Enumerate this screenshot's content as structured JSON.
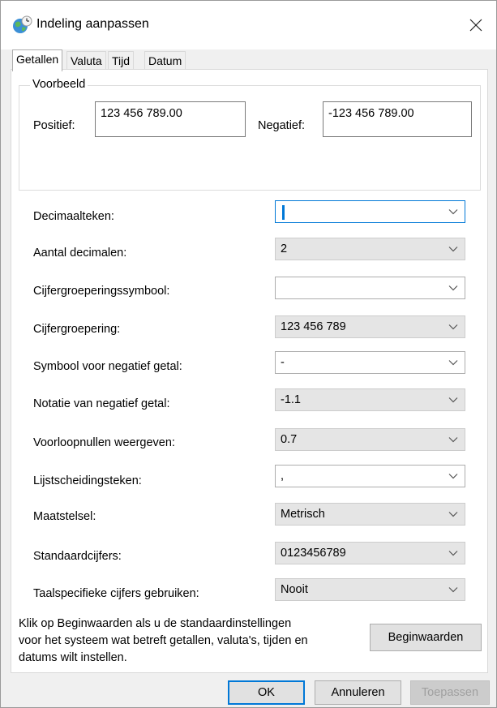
{
  "window": {
    "title": "Indeling aanpassen",
    "icon": "globe-clock-icon"
  },
  "tabs": [
    {
      "label": "Getallen",
      "active": true
    },
    {
      "label": "Valuta",
      "active": false
    },
    {
      "label": "Tijd",
      "active": false
    },
    {
      "label": "Datum",
      "active": false
    }
  ],
  "preview": {
    "legend": "Voorbeeld",
    "positive_label": "Positief:",
    "positive_value": "123 456 789.00",
    "negative_label": "Negatief:",
    "negative_value": "-123 456 789.00"
  },
  "settings": [
    {
      "label": "Decimaalteken:",
      "value": "",
      "editable": true,
      "focused": true
    },
    {
      "label": "Aantal decimalen:",
      "value": "2",
      "editable": false
    },
    {
      "label": "Cijfergroeperingssymbool:",
      "value": "",
      "editable": true
    },
    {
      "label": "Cijfergroepering:",
      "value": "123 456 789",
      "editable": false
    },
    {
      "label": "Symbool voor negatief getal:",
      "value": "-",
      "editable": true
    },
    {
      "label": "Notatie van negatief getal:",
      "value": "-1.1",
      "editable": false
    },
    {
      "label": "Voorloopnullen weergeven:",
      "value": "0.7",
      "editable": false
    },
    {
      "label": "Lijstscheidingsteken:",
      "value": ",",
      "editable": true
    },
    {
      "label": "Maatstelsel:",
      "value": "Metrisch",
      "editable": false
    },
    {
      "label": "Standaardcijfers:",
      "value": "0123456789",
      "editable": false
    },
    {
      "label": "Taalspecifieke cijfers gebruiken:",
      "value": "Nooit",
      "editable": false
    }
  ],
  "reset_info": {
    "lines": [
      "Klik op Beginwaarden als u de standaardinstellingen",
      "voor het systeem wat betreft getallen, valuta's, tijden en",
      "datums wilt instellen."
    ],
    "button_label": "Beginwaarden"
  },
  "footer": {
    "ok_label": "OK",
    "cancel_label": "Annuleren",
    "apply_label": "Toepassen"
  },
  "colors": {
    "accent": "#0078d7",
    "window_bg": "#f0f0f0",
    "panel_bg": "#ffffff",
    "readonly_combo_bg": "#e5e5e5",
    "disabled_text": "#a0a0a0"
  }
}
